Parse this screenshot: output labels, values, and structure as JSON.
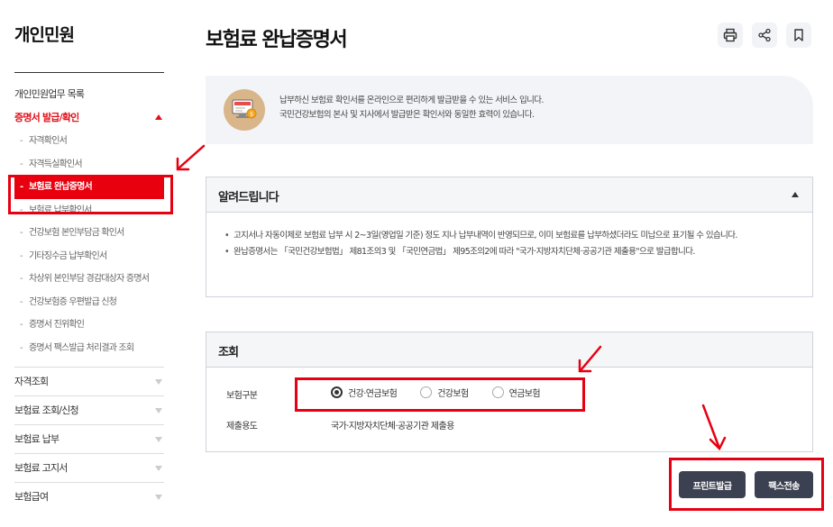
{
  "sidebar": {
    "title": "개인민원",
    "top_item": "개인민원업무 목록",
    "open_section": "증명서 발급/확인",
    "sub_items": [
      "자격확인서",
      "자격득실확인서",
      "보험료 완납증명서",
      "보험료 납부확인서",
      "건강보험 본인부담금 확인서",
      "기타징수금 납부확인서",
      "차상위 본인부담 경감대상자 증명서",
      "건강보험증 우편발급 신청",
      "증명서 진위확인",
      "증명서 팩스발급 처리결과 조회"
    ],
    "groups": [
      "자격조회",
      "보험료 조회/신청",
      "보험료 납부",
      "보험료 고지서",
      "보험급여"
    ]
  },
  "main": {
    "title": "보험료 완납증명서",
    "info_lines": [
      "납부하신 보험료 확인서를 온라인으로 편리하게 발급받을 수 있는 서비스 입니다.",
      "국민건강보험의 본사 및 지사에서 발급받은 확인서와 동일한 효력이 있습니다."
    ],
    "notice": {
      "title": "알려드립니다",
      "items": [
        "고지서나 자동이체로 보험료 납부 시 2~3일(영업일 기준) 정도 지나 납부내역이 반영되므로, 이미 보험료를 납부하셨더라도 미납으로 표기될 수 있습니다.",
        "완납증명서는 「국민건강보험법」 제81조의3 및 「국민연금법」 제95조의2에 따라 \"국가·지방자치단체·공공기관 제출용\"으로 발급합니다."
      ]
    },
    "query": {
      "title": "조회",
      "insurance_label": "보험구분",
      "options": [
        "건강·연금보험",
        "건강보험",
        "연금보험"
      ],
      "selected": "건강·연금보험",
      "purpose_label": "제출용도",
      "purpose_value": "국가·지방자치단체·공공기관 제출용"
    },
    "buttons": {
      "print": "프린트발급",
      "fax": "팩스전송"
    }
  },
  "colors": {
    "accent_red": "#e0111b",
    "button_dark": "#3b4150",
    "annotation_red": "#e60012"
  },
  "icons": {
    "print": "printer-icon",
    "share": "share-icon",
    "bookmark": "bookmark-icon",
    "service": "computer-coin-icon"
  }
}
